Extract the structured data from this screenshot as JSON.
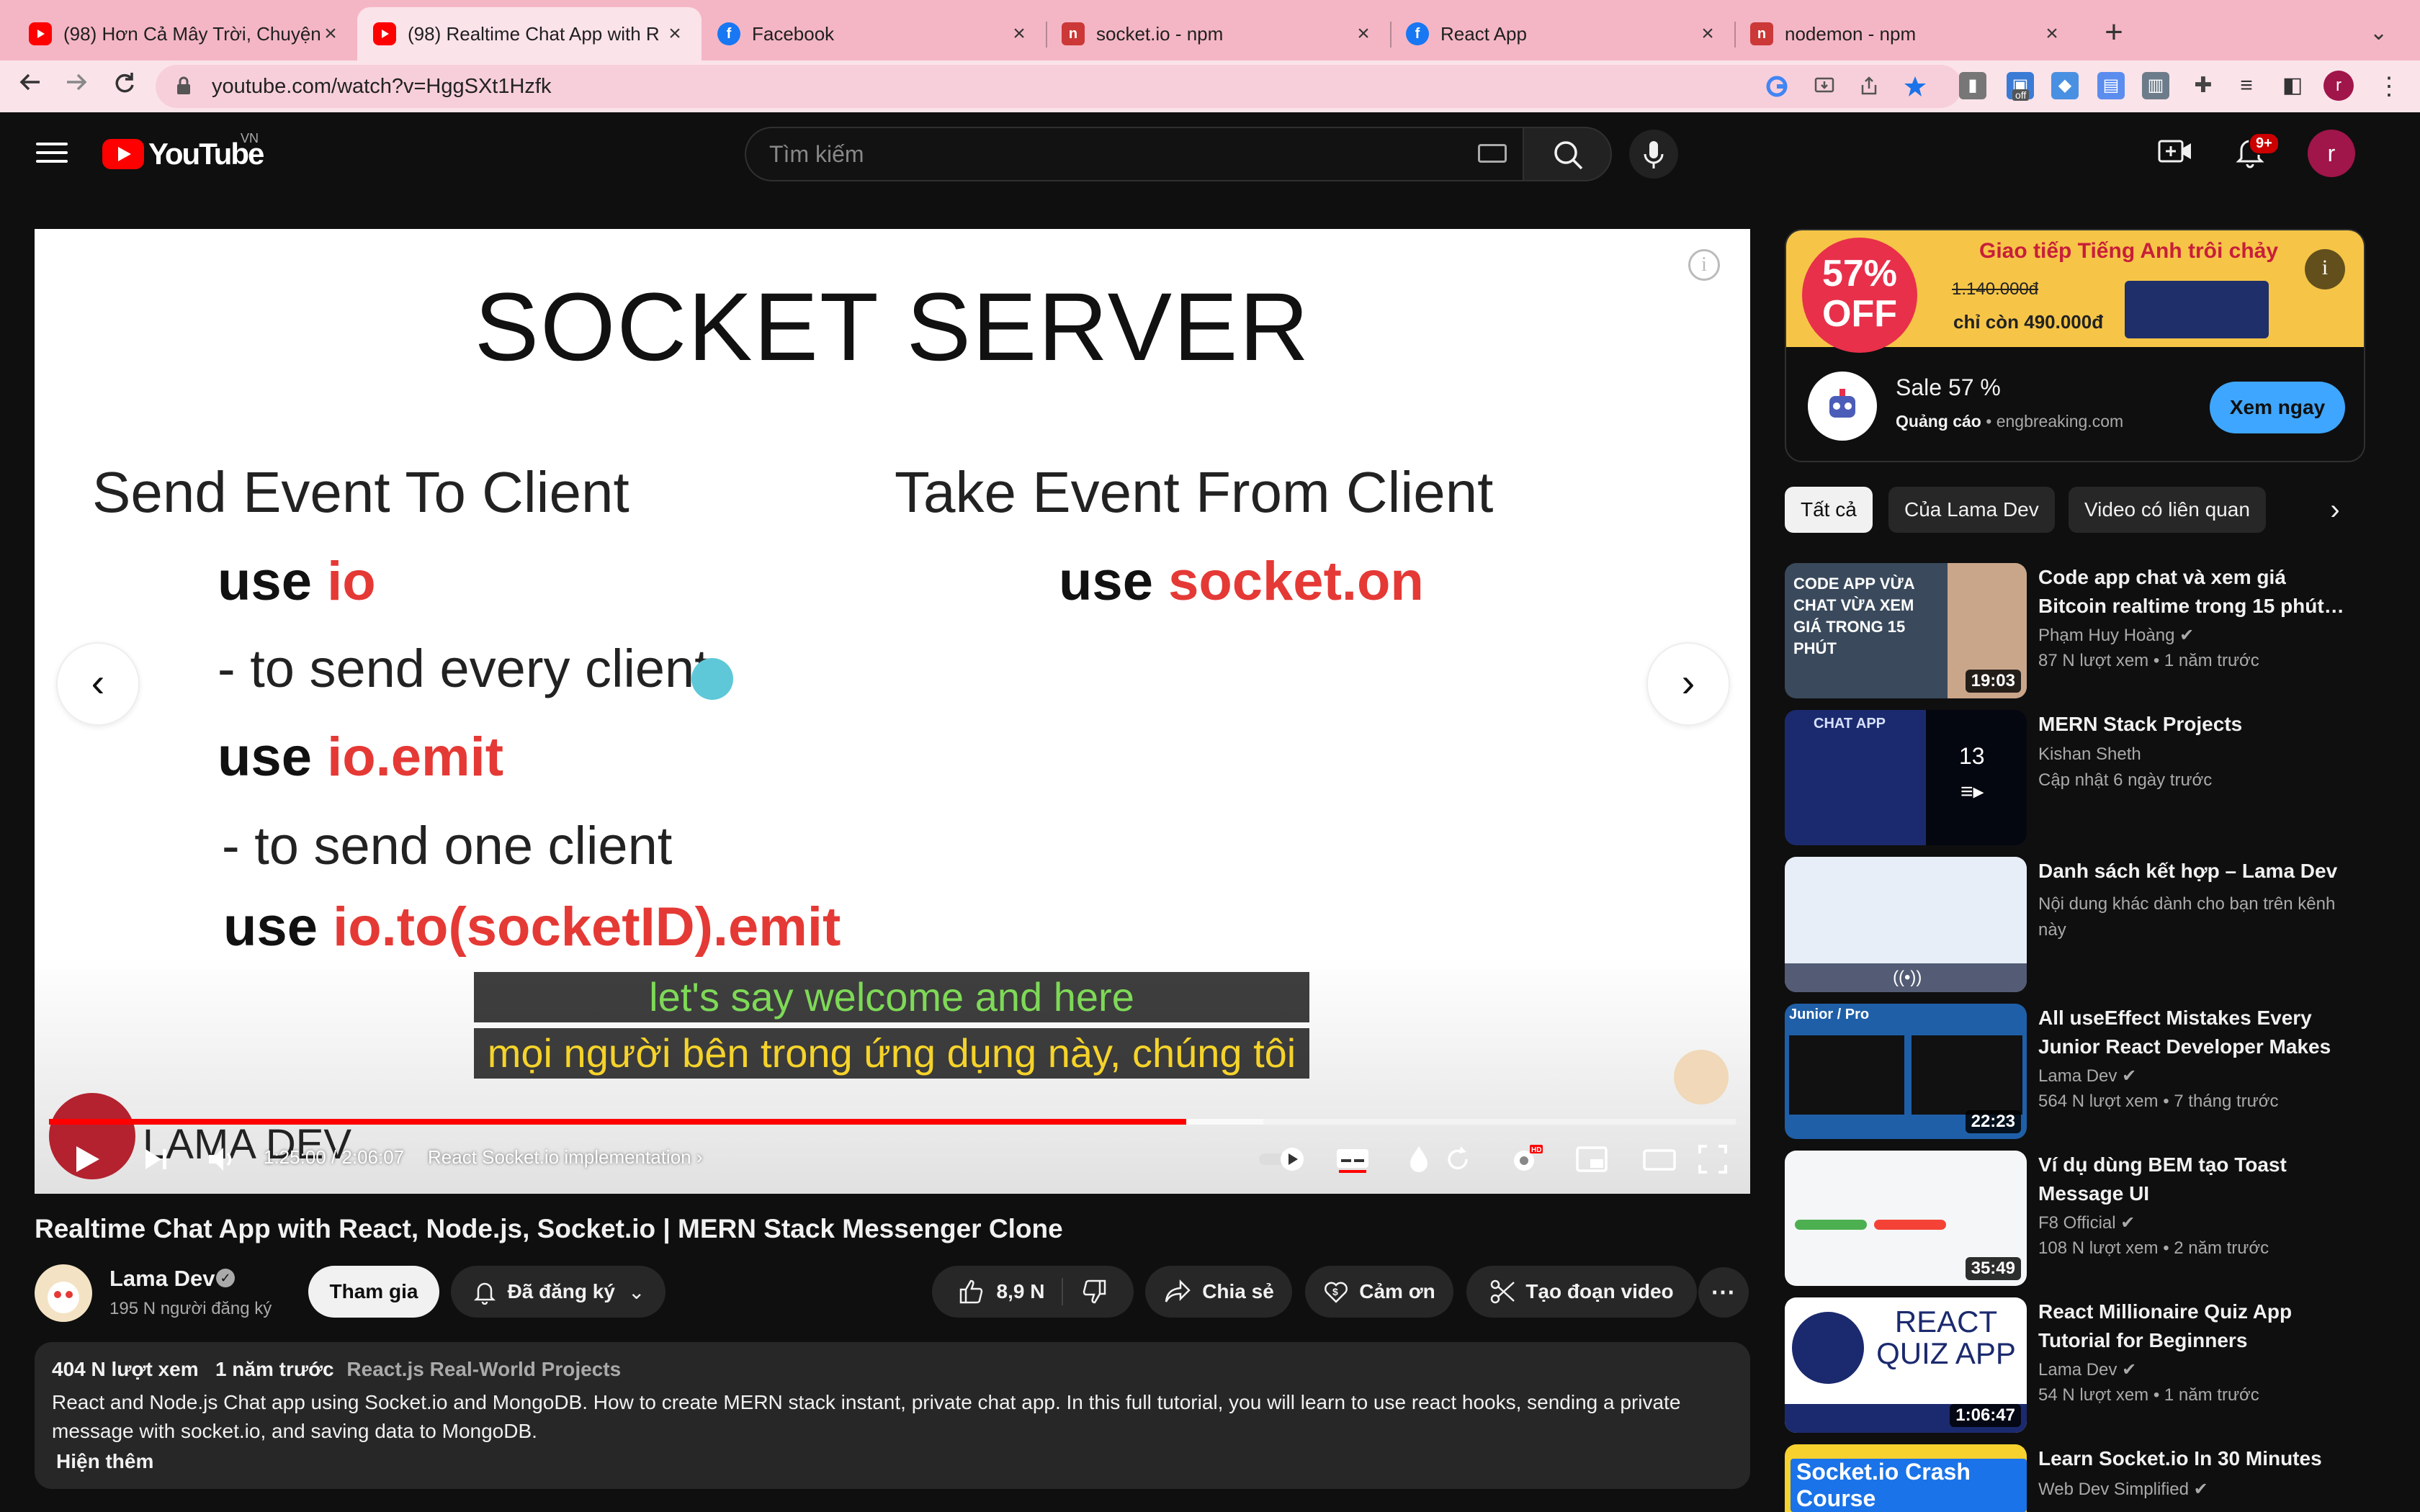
{
  "browser": {
    "tabs": [
      {
        "title": "(98) Hơn Cả Mây Trời, Chuyện",
        "icon": "youtube-icon",
        "active": false
      },
      {
        "title": "(98) Realtime Chat App with R",
        "icon": "youtube-icon",
        "active": true
      },
      {
        "title": "Facebook",
        "icon": "facebook-icon",
        "active": false
      },
      {
        "title": "socket.io - npm",
        "icon": "npm-icon",
        "active": false
      },
      {
        "title": "React App",
        "icon": "react-icon",
        "active": false
      },
      {
        "title": "nodemon - npm",
        "icon": "npm-icon",
        "active": false
      }
    ],
    "url": "youtube.com/watch?v=HggSXt1Hzfk",
    "profile_initial": "r",
    "ext_off_label": "off"
  },
  "header": {
    "logo_text": "YouTube",
    "region": "VN",
    "search_placeholder": "Tìm kiếm",
    "notif_badge": "9+",
    "avatar_initial": "r"
  },
  "player": {
    "slide": {
      "title": "SOCKET SERVER",
      "left_heading": "Send Event To Client",
      "right_heading": "Take Event From Client",
      "code1_kw": "use ",
      "code1_val": "io",
      "note1": "- to send every client",
      "code2_kw": "use ",
      "code2_val": "io.emit",
      "note2": "- to send one client",
      "code3_kw": "use ",
      "code3_val": "io.to(socketID).emit",
      "code4_kw": "use ",
      "code4_val": "socket.on"
    },
    "captions": {
      "line1": "let's say welcome and here",
      "line2": "mọi người bên trong ứng dụng này, chúng tôi"
    },
    "watermark": "LAMA DEV",
    "time_current": "1:25:00",
    "time_total": "2:06:07",
    "time_display": "1:25:00 / 2:06:07",
    "chapter": "React Socket.io implementation",
    "progress_fraction": 0.674,
    "buffered_fraction": 0.72,
    "hd_badge": "HD"
  },
  "video": {
    "title": "Realtime Chat App with React, Node.js, Socket.io | MERN Stack Messenger Clone",
    "channel": "Lama Dev",
    "subscribers": "195 N người đăng ký",
    "join_label": "Tham gia",
    "subscribed_label": "Đã đăng ký",
    "likes": "8,9 N",
    "share_label": "Chia sẻ",
    "thanks_label": "Cảm ơn",
    "clip_label": "Tạo đoạn video",
    "views": "404 N lượt xem",
    "age": "1 năm trước",
    "playlist_tag": "React.js Real-World Projects",
    "description": "React and Node.js Chat app using Socket.io and MongoDB. How to create MERN stack instant, private chat app. In this full tutorial, you will learn to use react hooks, sending a private message with socket.io, and saving data to MongoDB.",
    "show_more": "Hiện thêm"
  },
  "ad": {
    "discount_line1": "57%",
    "discount_line2": "OFF",
    "headline": "Giao tiếp Tiếng Anh trôi chảy",
    "old_price": "1.140.000đ",
    "new_price": "chỉ còn 490.000đ",
    "title": "Sale 57 %",
    "label": "Quảng cáo",
    "domain": "engbreaking.com",
    "cta": "Xem ngay"
  },
  "chips": [
    "Tất cả",
    "Của Lama Dev",
    "Video có liên quan"
  ],
  "recommendations": [
    {
      "title": "Code app chat và xem giá Bitcoin realtime trong 15 phút…",
      "channel": "Phạm Huy Hoàng",
      "verified": true,
      "meta": "87 N lượt xem  • 1 năm trước",
      "duration": "19:03",
      "thumb_color": "#3a4a5c",
      "thumb_text": "CODE APP VỪA CHAT VỪA XEM GIÁ TRONG 15 PHÚT"
    },
    {
      "title": "MERN Stack Projects",
      "channel": "Kishan Sheth",
      "verified": false,
      "meta": "Cập nhật 6 ngày trước",
      "duration": "",
      "playlist_count": "13",
      "thumb_color": "#1b2a6e",
      "thumb_text": "CHAT APP"
    },
    {
      "title": "Danh sách kết hợp – Lama Dev",
      "channel": "Nội dung khác dành cho bạn trên kênh này",
      "verified": false,
      "meta": "",
      "duration": "",
      "thumb_color": "#e8eef8",
      "thumb_text": ""
    },
    {
      "title": "All useEffect Mistakes Every Junior React Developer Makes",
      "channel": "Lama Dev",
      "verified": true,
      "meta": "564 N lượt xem  • 7 tháng trước",
      "duration": "22:23",
      "thumb_color": "#1f5fa8",
      "thumb_text": "Junior / Pro"
    },
    {
      "title": "Ví dụ dùng BEM tạo Toast Message UI",
      "channel": "F8 Official",
      "verified": true,
      "meta": "108 N lượt xem  • 2 năm trước",
      "duration": "35:49",
      "thumb_color": "#f4f6f8",
      "thumb_text": ""
    },
    {
      "title": "React Millionaire Quiz App Tutorial for Beginners",
      "channel": "Lama Dev",
      "verified": true,
      "meta": "54 N lượt xem  • 1 năm trước",
      "duration": "1:06:47",
      "thumb_color": "#ffffff",
      "thumb_text": "REACT QUIZ APP"
    },
    {
      "title": "Learn Socket.io In 30 Minutes",
      "channel": "Web Dev Simplified",
      "verified": true,
      "meta": "",
      "duration": "",
      "thumb_color": "#f7d12e",
      "thumb_text": "Socket.io Crash Course"
    }
  ]
}
